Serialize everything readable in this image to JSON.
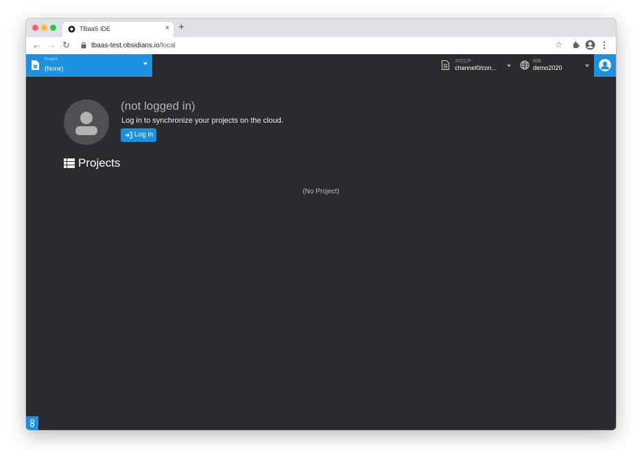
{
  "browser": {
    "tab_title": "TBaaS IDE",
    "tab_close": "×",
    "new_tab": "+",
    "url_host": "tbaas-test.obsidians.io",
    "url_path": "/local",
    "back": "←",
    "forward": "→",
    "reload": "↻",
    "bookmark": "☆"
  },
  "header": {
    "project_label": "Project",
    "project_value": "(None)",
    "contract_label": "合约文件",
    "contract_value": "channel0/con...",
    "network_label": "网络",
    "network_value": "demo2020"
  },
  "main": {
    "status": "(not logged in)",
    "sync_text": "Log in to synchronize your projects on the cloud.",
    "login_button": "Log in",
    "projects_title": "Projects",
    "empty_text": "(No Project)"
  },
  "colors": {
    "accent": "#1e90e0",
    "background": "#2b2b2d"
  }
}
